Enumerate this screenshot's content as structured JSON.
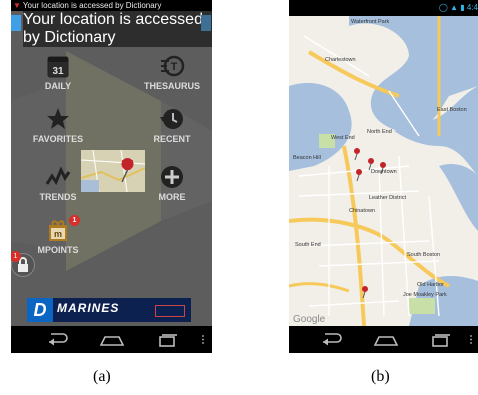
{
  "panel_a": {
    "status_text": "Your location is accessed by Dictionary",
    "dialog_text": "Your location is accessed by Dictionary",
    "apps": [
      {
        "label": "DAILY",
        "icon": "calendar-icon",
        "calendar_day": "31"
      },
      {
        "label": "THESAURUS",
        "icon": "thesaurus-icon",
        "glyph": "T"
      },
      {
        "label": "FAVORITES",
        "icon": "star-icon"
      },
      {
        "label": "RECENT",
        "icon": "history-icon"
      },
      {
        "label": "TRENDS",
        "icon": "trends-icon"
      },
      {
        "label": "MORE",
        "icon": "plus-icon"
      },
      {
        "label": "MPOINTS",
        "icon": "gift-icon",
        "badge": "1",
        "glyph": "m"
      }
    ],
    "ad": {
      "text": "MARINES",
      "brand_letter": "D"
    },
    "lock_badge": "1",
    "caption": "(a)"
  },
  "panel_b": {
    "status_time": "4:4",
    "map": {
      "labels": [
        "Waterfront Park",
        "Charlestown",
        "East Boston",
        "North End",
        "West End",
        "Beacon Hill",
        "Downtown",
        "Leather District",
        "South End",
        "South Boston",
        "Old Harbor",
        "Joe Moakley Park",
        "Chinatown"
      ],
      "watermark": "Google",
      "water_color": "#a5bfdd",
      "land_color": "#f2efe9",
      "highway_color": "#f6c95a",
      "road_color": "#ffffff"
    },
    "caption": "(b)"
  }
}
